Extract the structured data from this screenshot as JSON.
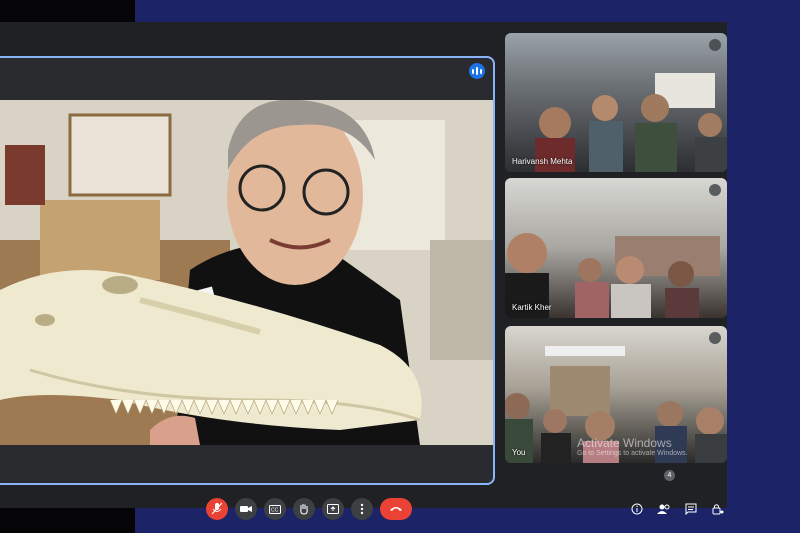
{
  "colors": {
    "accent": "#8ab4f8",
    "danger": "#ea4335",
    "meet_bg": "#202124",
    "page_bg": "#1c2366"
  },
  "main_tile": {
    "speaking_indicator": "speaking-icon",
    "description_subject": "presenter holding crocodile skull"
  },
  "participants": [
    {
      "name": "Harivansh Mehta",
      "muted": true
    },
    {
      "name": "Kartik Kher",
      "muted": true
    },
    {
      "name": "You",
      "muted": true
    }
  ],
  "toolbar": {
    "controls": [
      "mic-off-icon",
      "camera-icon",
      "captions-icon",
      "raise-hand-icon",
      "present-icon",
      "more-icon",
      "end-call-icon"
    ],
    "right_icons": [
      "info-icon",
      "people-icon",
      "chat-icon",
      "host-controls-icon"
    ],
    "people_count": "4"
  },
  "watermark": {
    "line1": "Activate Windows",
    "line2": "Go to Settings to activate Windows."
  }
}
